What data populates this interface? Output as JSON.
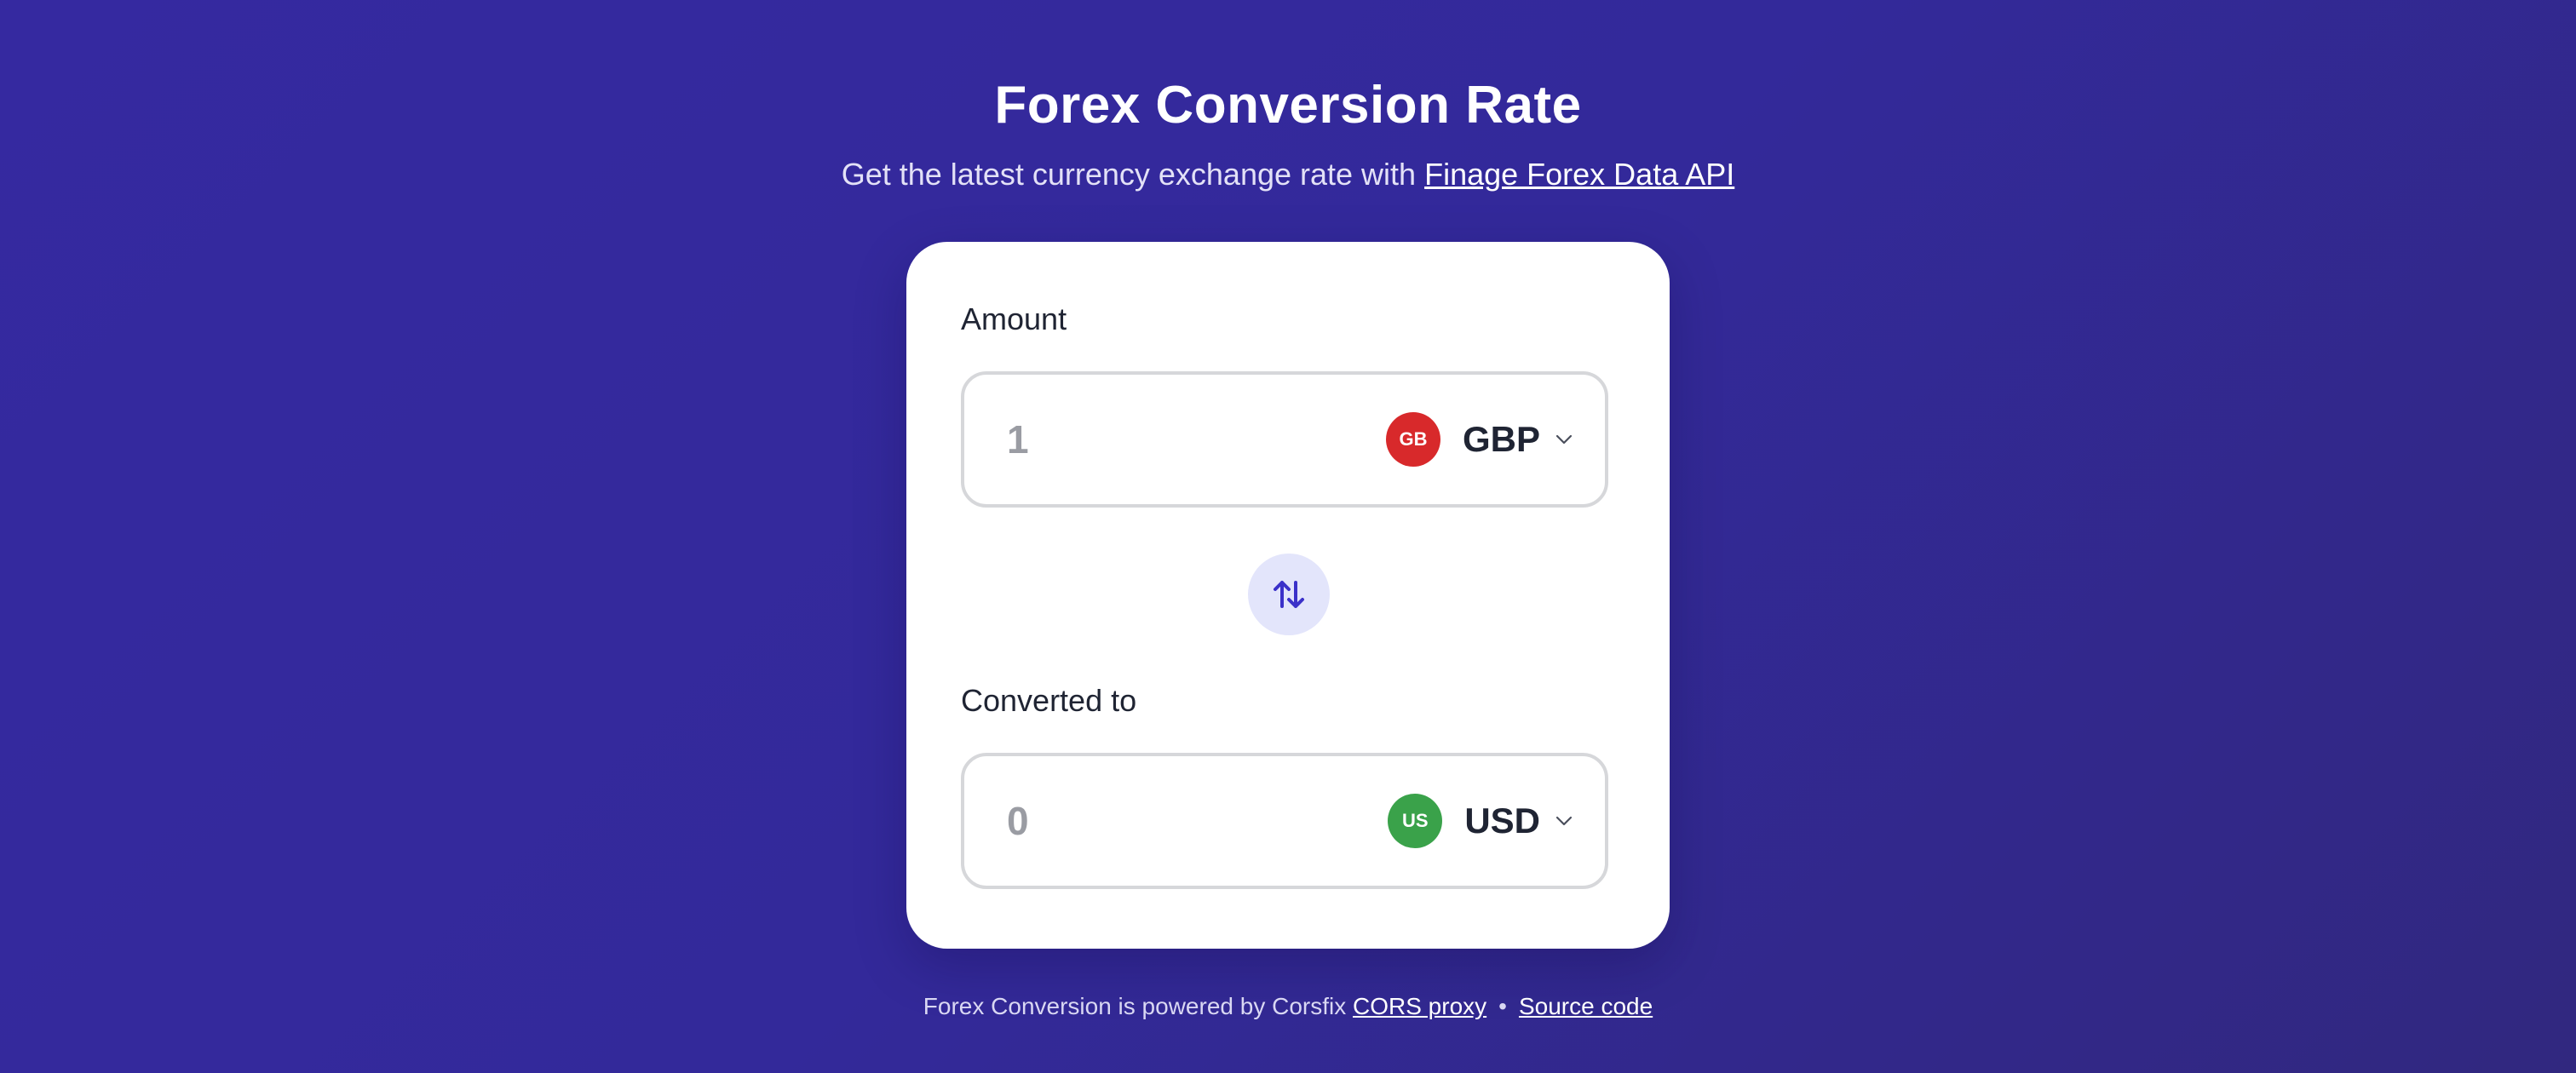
{
  "header": {
    "title": "Forex Conversion Rate",
    "subtitle_prefix": "Get the latest currency exchange rate with ",
    "subtitle_link": "Finage Forex Data API"
  },
  "converter": {
    "amount_label": "Amount",
    "amount_value": "1",
    "from_currency": {
      "code": "GBP",
      "flag_text": "GB",
      "flag_color": "#d8292b"
    },
    "converted_label": "Converted to",
    "converted_value": "0",
    "to_currency": {
      "code": "USD",
      "flag_text": "US",
      "flag_color": "#3aa24a"
    },
    "swap_icon": "swap-arrows-icon"
  },
  "footer": {
    "prefix": "Forex Conversion is powered by Corsfix ",
    "proxy_link": "CORS proxy",
    "separator": "•",
    "source_link": "Source code"
  },
  "colors": {
    "background": "#3329a0",
    "accent": "#3b31c9",
    "swap_bg": "#e3e5fb"
  }
}
